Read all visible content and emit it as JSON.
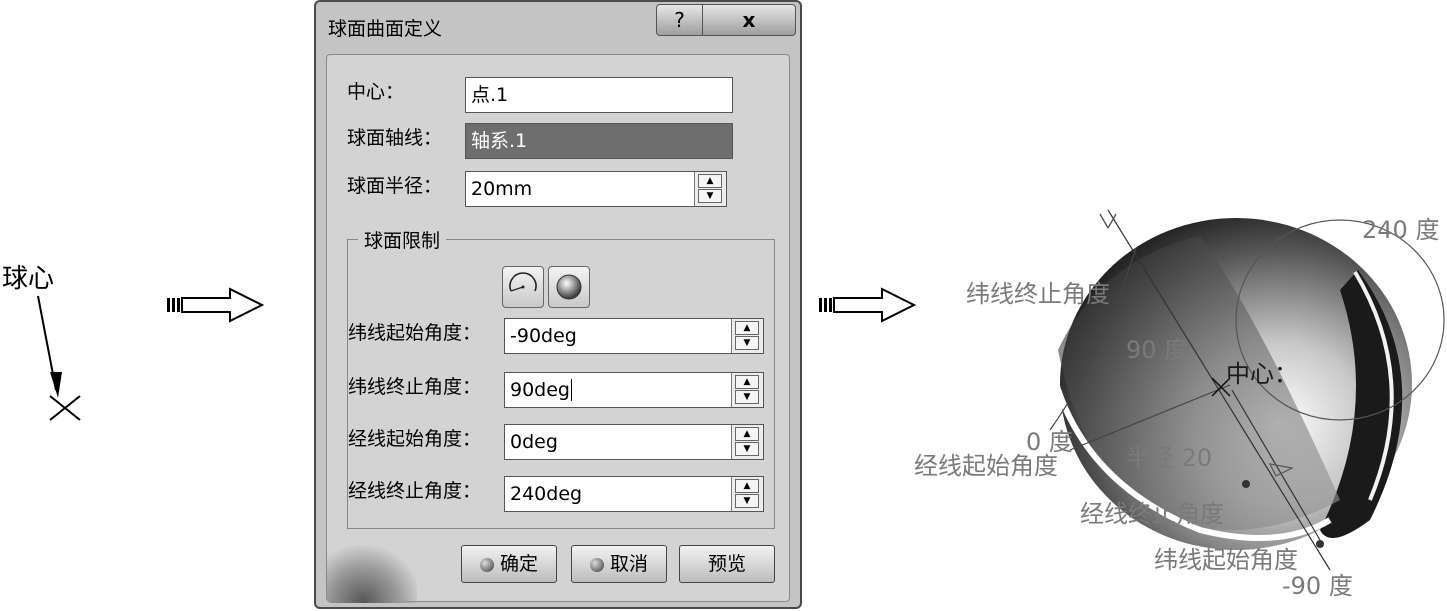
{
  "left_annotation": {
    "label": "球心"
  },
  "dialog": {
    "title": "球面曲面定义",
    "help_label": "?",
    "close_label": "x",
    "center_label": "中心：",
    "center_value": "点.1",
    "axis_label": "球面轴线：",
    "axis_value": "轴系.1",
    "radius_label": "球面半径：",
    "radius_value": "20mm",
    "limits_group": {
      "title": "球面限制",
      "mode_icons": [
        "partial-sphere-icon",
        "full-sphere-icon"
      ],
      "rows": [
        {
          "label": "纬线起始角度：",
          "value": "-90deg"
        },
        {
          "label": "纬线终止角度：",
          "value": "90deg"
        },
        {
          "label": "经线起始角度：",
          "value": "0deg"
        },
        {
          "label": "经线终止角度：",
          "value": "240deg"
        }
      ]
    },
    "buttons": {
      "ok": "确定",
      "cancel": "取消",
      "preview": "预览"
    }
  },
  "preview_labels": {
    "deg_240": "240 度",
    "lat_end": "纬线终止角度",
    "deg_90": "90 度",
    "center": "中心：",
    "deg_0": "0 度",
    "lon_start": "经线起始角度",
    "radius": "半径 20",
    "lon_end": "经线终止角度",
    "lat_start": "纬线起始角度",
    "deg_neg90": "-90 度"
  }
}
